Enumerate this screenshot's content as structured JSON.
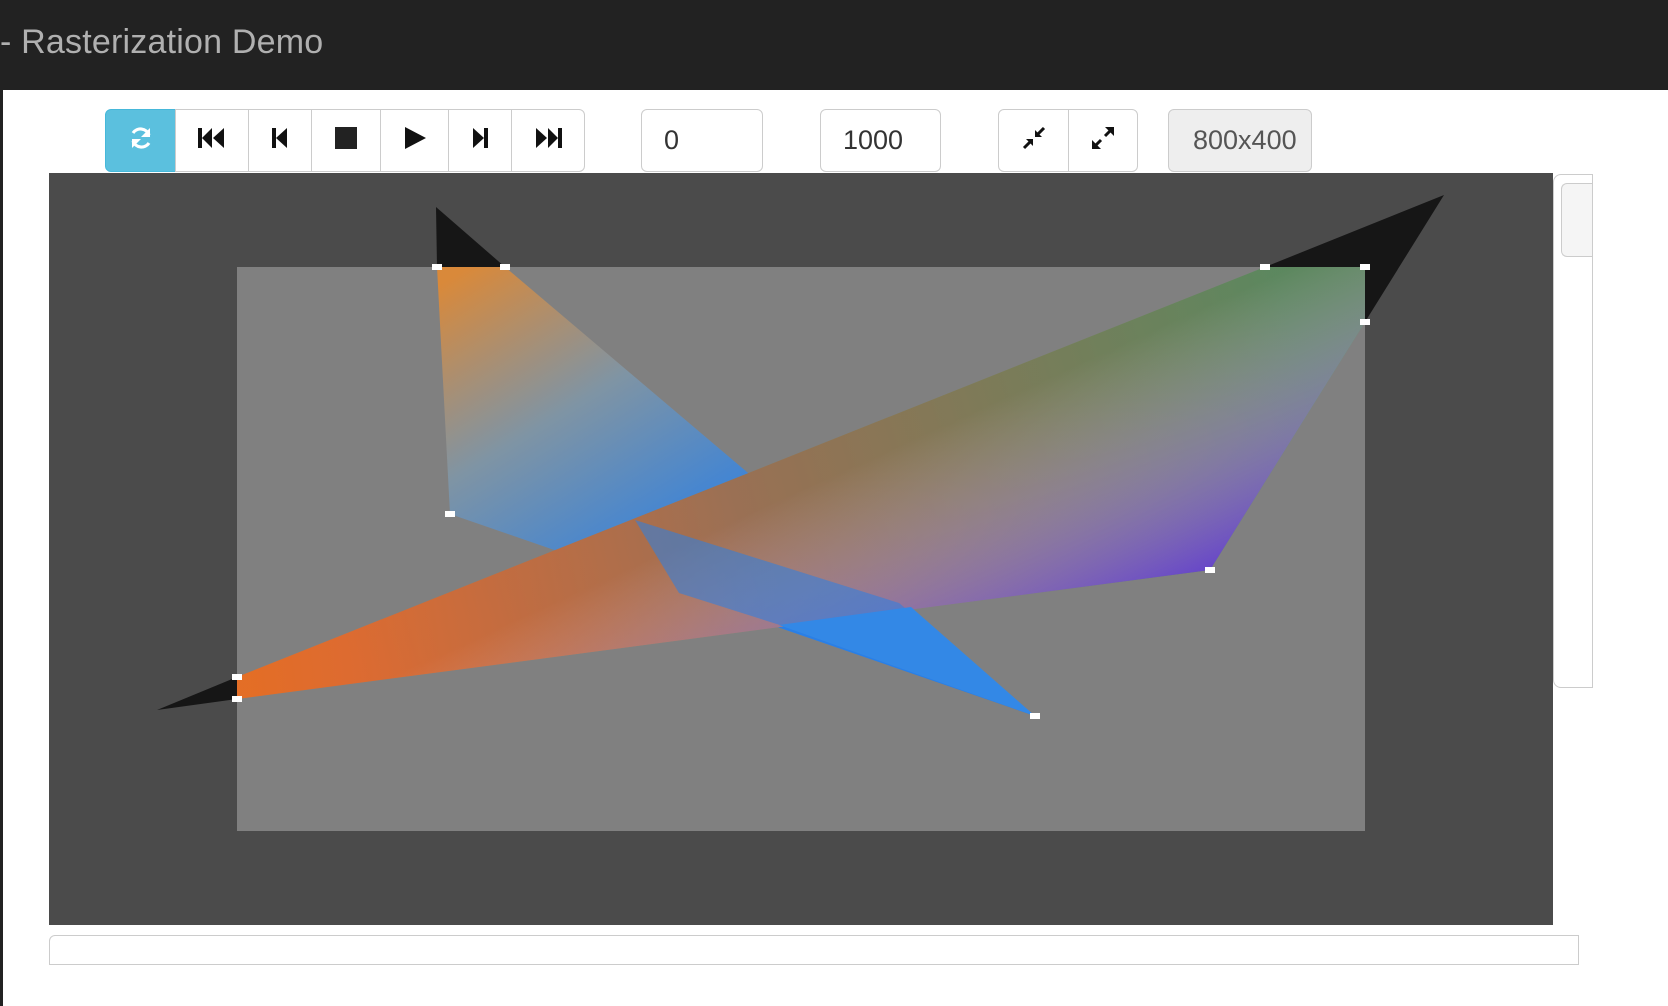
{
  "app": {
    "title": "- Rasterization Demo"
  },
  "toolbar": {
    "playback": [
      {
        "name": "refresh-button",
        "icon": "refresh-icon",
        "active": true
      },
      {
        "name": "skip-to-start-button",
        "icon": "fast-backward-icon",
        "active": false
      },
      {
        "name": "step-back-button",
        "icon": "step-backward-icon",
        "active": false
      },
      {
        "name": "stop-button",
        "icon": "stop-icon",
        "active": false
      },
      {
        "name": "play-button",
        "icon": "play-icon",
        "active": false
      },
      {
        "name": "step-forward-button",
        "icon": "step-forward-icon",
        "active": false
      },
      {
        "name": "skip-to-end-button",
        "icon": "fast-forward-icon",
        "active": false
      }
    ],
    "start_value": "0",
    "end_value": "1000",
    "zoom": [
      {
        "name": "shrink-button",
        "icon": "compress-icon"
      },
      {
        "name": "expand-button",
        "icon": "expand-icon"
      }
    ],
    "resolution": "800x400"
  },
  "colors": {
    "topbar": "#222222",
    "accent": "#5bc0de",
    "canvas_bg": "#4b4b4b",
    "viewport_bg": "#808080",
    "clipped_fill": "#161616",
    "vertex_marker": "#ffffff"
  }
}
